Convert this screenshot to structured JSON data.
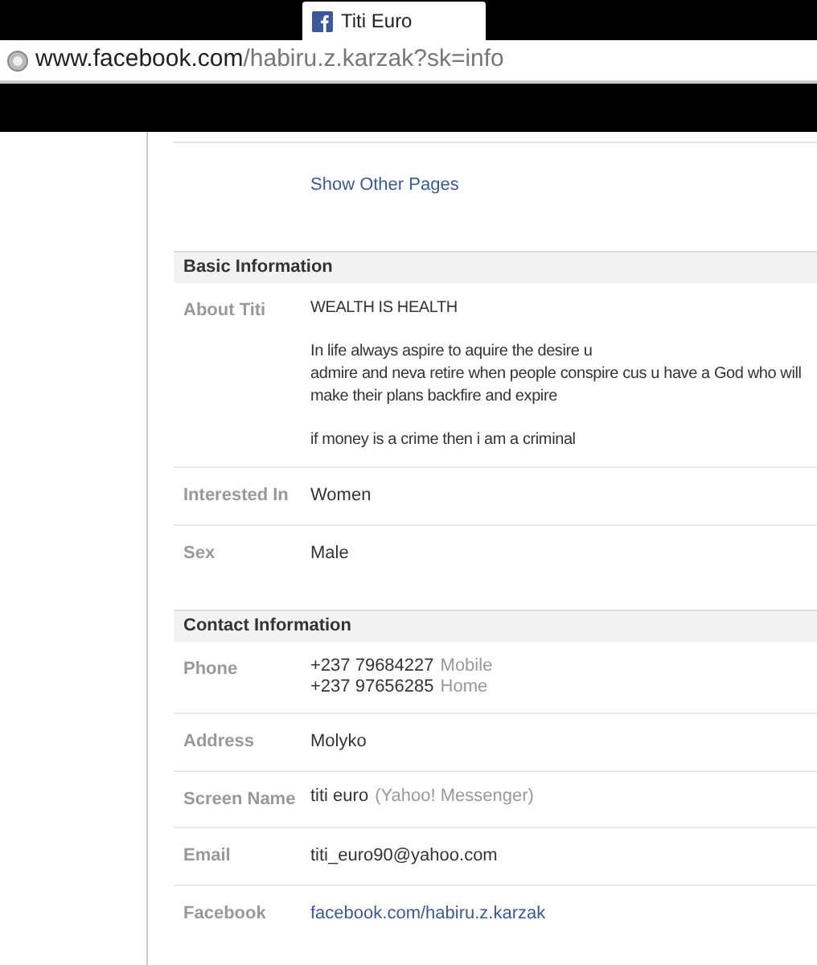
{
  "browser": {
    "tab_title": "Titi Euro",
    "url_host": "www.facebook.com",
    "url_path": "/habiru.z.karzak?sk=info"
  },
  "show_other_pages": "Show Other Pages",
  "sections": [
    {
      "title": "Basic Information",
      "rows": [
        {
          "label": "About Titi",
          "kind": "paragraphs",
          "paragraphs": [
            [
              "WEALTH IS HEALTH"
            ],
            [
              "In life always aspire to aquire the desire u",
              "admire and neva retire when people conspire cus u have a God who will",
              "make their plans backfire and expire"
            ],
            [
              "if money is a crime then i am a criminal"
            ]
          ]
        },
        {
          "label": "Interested In",
          "kind": "text",
          "value": "Women"
        },
        {
          "label": "Sex",
          "kind": "text",
          "value": "Male"
        }
      ]
    },
    {
      "title": "Contact Information",
      "rows": [
        {
          "label": "Phone",
          "kind": "entries",
          "entries": [
            {
              "value": "+237 79684227",
              "note": "Mobile"
            },
            {
              "value": "+237 97656285",
              "note": "Home"
            }
          ]
        },
        {
          "label": "Address",
          "kind": "text",
          "value": "Molyko"
        },
        {
          "label": "Screen Name",
          "kind": "entries",
          "entries": [
            {
              "value": "titi euro",
              "note": "(Yahoo! Messenger)"
            }
          ]
        },
        {
          "label": "Email",
          "kind": "text",
          "value": "titi_euro90@yahoo.com"
        },
        {
          "label": "Facebook",
          "kind": "link",
          "value": "facebook.com/habiru.z.karzak"
        }
      ]
    }
  ]
}
